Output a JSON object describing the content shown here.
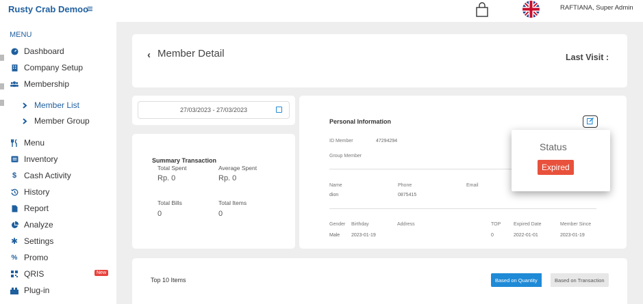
{
  "app": {
    "brand": "Rusty Crab Demoo"
  },
  "topbar": {
    "user": "RAFTIANA, Super Admin"
  },
  "sidebar": {
    "menu_label": "MENU",
    "items": [
      {
        "label": "Dashboard",
        "icon": "dashboard-icon"
      },
      {
        "label": "Company Setup",
        "icon": "building-icon"
      },
      {
        "label": "Membership",
        "icon": "users-icon"
      },
      {
        "label": "Member List",
        "icon": "chevron-right-icon"
      },
      {
        "label": "Member Group",
        "icon": "chevron-right-icon"
      },
      {
        "label": "Menu",
        "icon": "utensils-icon"
      },
      {
        "label": "Inventory",
        "icon": "inventory-icon"
      },
      {
        "label": "Cash Activity",
        "icon": "dollar-icon"
      },
      {
        "label": "History",
        "icon": "history-icon"
      },
      {
        "label": "Report",
        "icon": "file-icon"
      },
      {
        "label": "Analyze",
        "icon": "pie-chart-icon"
      },
      {
        "label": "Settings",
        "icon": "gear-icon"
      },
      {
        "label": "Promo",
        "icon": "percent-icon"
      },
      {
        "label": "QRIS",
        "icon": "qr-icon"
      },
      {
        "label": "Plug-in",
        "icon": "plugin-icon"
      }
    ],
    "new_badge": "New"
  },
  "header": {
    "title": "Member Detail",
    "last_visit": "Last Visit :"
  },
  "date_range": "27/03/2023 - 27/03/2023",
  "summary": {
    "title": "Summary Transaction",
    "total_spent_label": "Total Spent",
    "total_spent": "Rp. 0",
    "avg_spent_label": "Average Spent",
    "avg_spent": "Rp. 0",
    "total_bills_label": "Total Bills",
    "total_bills": "0",
    "total_items_label": "Total Items",
    "total_items": "0"
  },
  "personal": {
    "title": "Personal Information",
    "id_label": "ID Member",
    "id_value": "47294294",
    "group_label": "Group Member",
    "name_label": "Name",
    "name_value": "dion",
    "phone_label": "Phone",
    "phone_value": "0875415",
    "email_label": "Email",
    "gender_label": "Gender",
    "gender_value": "Male",
    "birthday_label": "Birthday",
    "birthday_value": "2023-01-19",
    "address_label": "Address",
    "top_label": "TOP",
    "top_value": "0",
    "expired_label": "Expired Date",
    "expired_value": "2022-01-01",
    "since_label": "Member Since",
    "since_value": "2023-01-19"
  },
  "status": {
    "label": "Status",
    "value": "Expired"
  },
  "top_items": {
    "title": "Top 10 Items",
    "btn_quantity": "Based on Quantity",
    "btn_transaction": "Based on Transaction"
  },
  "colors": {
    "brand": "#1f5f9e",
    "accent": "#1f8ad6",
    "danger": "#e8513b"
  }
}
